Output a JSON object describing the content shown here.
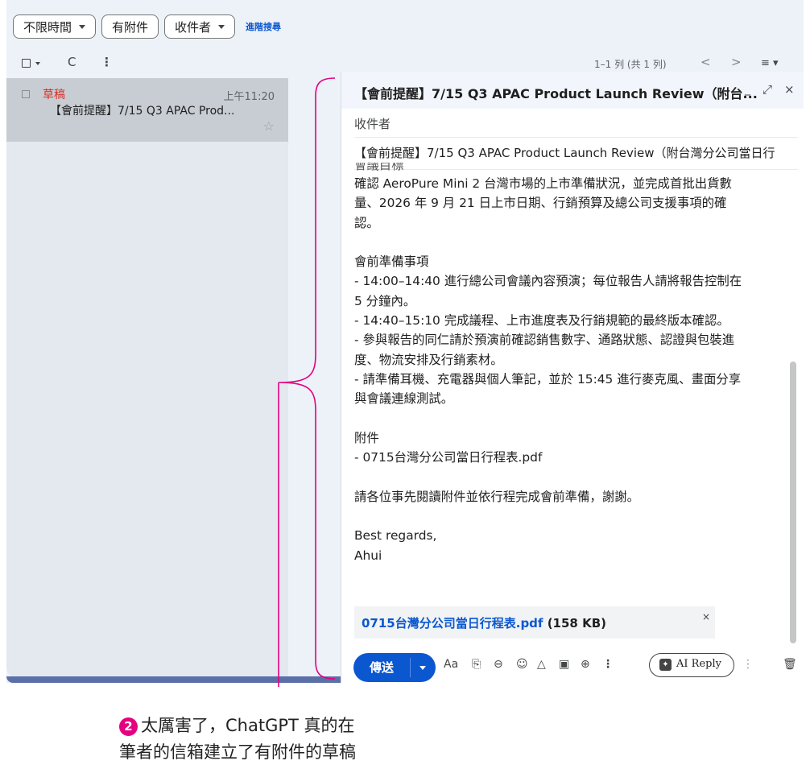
{
  "filters": {
    "time": "不限時間",
    "attachment": "有附件",
    "recipient": "收件者",
    "advanced_search": "進階搜尋"
  },
  "toolbar": {
    "select_icon": "checkbox-icon",
    "refresh_glyph": "C",
    "more_glyph": "⋮",
    "count": "1–1 列 (共 1 列)",
    "prev_glyph": "<",
    "next_glyph": ">",
    "density_glyph": "≡ ▾"
  },
  "list": {
    "row": {
      "label": "草稿",
      "time": "上午11:20",
      "subject": "【會前提醒】7/15 Q3 APAC Prod...",
      "star_glyph": "☆"
    }
  },
  "compose": {
    "title": "【會前提醒】7/15 Q3 APAC Product Launch Review（附台...",
    "min_glyph": "_",
    "expand_glyph": "⤢",
    "close_glyph": "×",
    "to_label": "收件者",
    "subject": "【會前提醒】7/15 Q3 APAC Product Launch Review（附台灣分公司當日行",
    "body": {
      "cut_line": "會議目標",
      "p1": "確認 AeroPure Mini 2 台灣市場的上市準備狀況，並完成首批出貨數\n量、2026 年 9 月 21 日上市日期、行銷預算及總公司支援事項的確\n認。",
      "p2": "會前準備事項\n- 14:00–14:40 進行總公司會議內容預演；每位報告人請將報告控制在\n5 分鐘內。\n- 14:40–15:10 完成議程、上市進度表及行銷規範的最終版本確認。\n- 參與報告的同仁請於預演前確認銷售數字、通路狀態、認證與包裝進\n度、物流安排及行銷素材。\n- 請準備耳機、充電器與個人筆記，並於 15:45 進行麥克風、畫面分享\n與會議連線測試。",
      "p3": "附件\n- 0715台灣分公司當日行程表.pdf",
      "p4": "請各位事先閱讀附件並依行程完成會前準備，謝謝。",
      "p5": "Best regards,\nAhui"
    },
    "attachment": {
      "name": "0715台灣分公司當日行程表.pdf",
      "size": "(158 KB)",
      "close_glyph": "×"
    },
    "footer": {
      "send": "傳送",
      "format_glyph": "Aa",
      "attach_glyph": "⎘",
      "link_glyph": "⊖",
      "emoji_glyph": "☺",
      "drive_glyph": "△",
      "photo_glyph": "▣",
      "lock_glyph": "⊕",
      "more_glyph": "⋮",
      "ai_reply": "AI Reply",
      "ai_more_glyph": "⋮",
      "delete_glyph": "🗑"
    }
  },
  "annotation": {
    "badge": "2",
    "line1": "太厲害了，ChatGPT 真的在",
    "line2": "筆者的信箱建立了有附件的草稿"
  },
  "colors": {
    "accent": "#0b57d0",
    "draft_red": "#d93025",
    "annotation_pink": "#e4007f",
    "app_bg": "#edf1f8"
  }
}
